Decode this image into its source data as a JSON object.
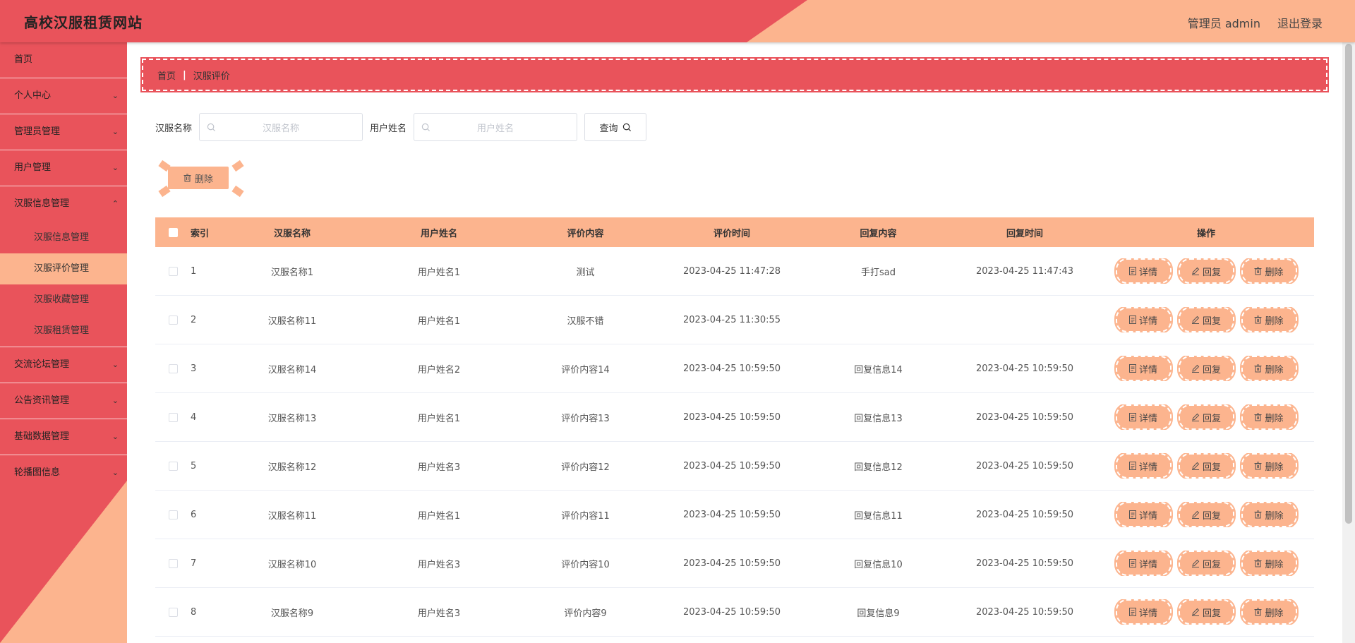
{
  "header": {
    "site_title": "高校汉服租赁网站",
    "user": "管理员 admin",
    "logout": "退出登录"
  },
  "sidebar": {
    "items": [
      {
        "label": "首页"
      },
      {
        "label": "个人中心"
      },
      {
        "label": "管理员管理"
      },
      {
        "label": "用户管理"
      },
      {
        "label": "汉服信息管理"
      },
      {
        "label": "交流论坛管理"
      },
      {
        "label": "公告资讯管理"
      },
      {
        "label": "基础数据管理"
      },
      {
        "label": "轮播图信息"
      }
    ],
    "sub_items": [
      {
        "label": "汉服信息管理"
      },
      {
        "label": "汉服评价管理"
      },
      {
        "label": "汉服收藏管理"
      },
      {
        "label": "汉服租赁管理"
      }
    ]
  },
  "breadcrumb": {
    "home": "首页",
    "current": "汉服评价"
  },
  "search": {
    "name_label": "汉服名称",
    "name_placeholder": "汉服名称",
    "user_label": "用户姓名",
    "user_placeholder": "用户姓名",
    "query": "查询"
  },
  "toolbar": {
    "delete": "删除"
  },
  "table": {
    "headers": [
      "索引",
      "汉服名称",
      "用户姓名",
      "评价内容",
      "评价时间",
      "回复内容",
      "回复时间",
      "操作"
    ],
    "ops": {
      "detail": "详情",
      "reply": "回复",
      "delete": "删除"
    },
    "rows": [
      [
        "1",
        "汉服名称1",
        "用户姓名1",
        "测试",
        "2023-04-25 11:47:28",
        "手打sad",
        "2023-04-25 11:47:43"
      ],
      [
        "2",
        "汉服名称11",
        "用户姓名1",
        "汉服不错",
        "2023-04-25 11:30:55",
        "",
        ""
      ],
      [
        "3",
        "汉服名称14",
        "用户姓名2",
        "评价内容14",
        "2023-04-25 10:59:50",
        "回复信息14",
        "2023-04-25 10:59:50"
      ],
      [
        "4",
        "汉服名称13",
        "用户姓名1",
        "评价内容13",
        "2023-04-25 10:59:50",
        "回复信息13",
        "2023-04-25 10:59:50"
      ],
      [
        "5",
        "汉服名称12",
        "用户姓名3",
        "评价内容12",
        "2023-04-25 10:59:50",
        "回复信息12",
        "2023-04-25 10:59:50"
      ],
      [
        "6",
        "汉服名称11",
        "用户姓名1",
        "评价内容11",
        "2023-04-25 10:59:50",
        "回复信息11",
        "2023-04-25 10:59:50"
      ],
      [
        "7",
        "汉服名称10",
        "用户姓名3",
        "评价内容10",
        "2023-04-25 10:59:50",
        "回复信息10",
        "2023-04-25 10:59:50"
      ],
      [
        "8",
        "汉服名称9",
        "用户姓名3",
        "评价内容9",
        "2023-04-25 10:59:50",
        "回复信息9",
        "2023-04-25 10:59:50"
      ]
    ]
  },
  "colors": {
    "primary": "#e9535b",
    "accent": "#fcb48e"
  }
}
